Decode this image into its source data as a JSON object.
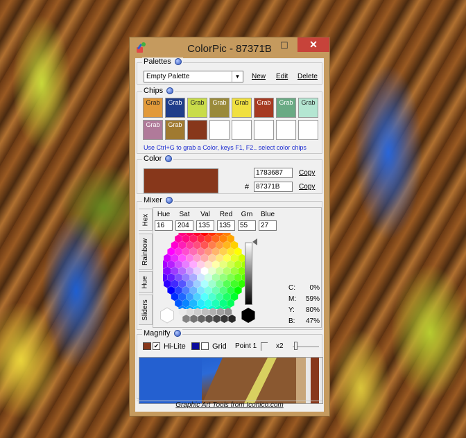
{
  "window": {
    "title": "ColorPic - 87371B",
    "minimize": "–",
    "maximize": "☐",
    "close": "✕"
  },
  "palettes": {
    "label": "Palettes",
    "selected": "Empty Palette",
    "new_label": "New",
    "edit_label": "Edit",
    "delete_label": "Delete"
  },
  "chips": {
    "label": "Chips",
    "items": [
      {
        "label": "Grab",
        "color": "#e29a3a"
      },
      {
        "label": "Grab",
        "color": "#1f3d8a"
      },
      {
        "label": "Grab",
        "color": "#c9dc4a"
      },
      {
        "label": "Grab",
        "color": "#9a8a3a"
      },
      {
        "label": "Grab",
        "color": "#f0e040"
      },
      {
        "label": "Grab",
        "color": "#a63a22"
      },
      {
        "label": "Grab",
        "color": "#6aaa84"
      },
      {
        "label": "Grab",
        "color": "#b4e6d2"
      },
      {
        "label": "Grab",
        "color": "#b07a9a"
      },
      {
        "label": "Grab",
        "color": "#a07a30"
      },
      {
        "label": "",
        "color": "#87371b"
      },
      {
        "label": "",
        "color": "#ffffff"
      },
      {
        "label": "",
        "color": "#ffffff"
      },
      {
        "label": "",
        "color": "#ffffff"
      },
      {
        "label": "",
        "color": "#ffffff"
      },
      {
        "label": "",
        "color": "#ffffff"
      }
    ],
    "hint": "Use Ctrl+G to grab a Color, keys F1, F2.. select color chips"
  },
  "color": {
    "label": "Color",
    "swatch": "#87371b",
    "decimal": "1783687",
    "hash": "#",
    "hex": "87371B",
    "copy1": "Copy",
    "copy2": "Copy"
  },
  "mixer": {
    "label": "Mixer",
    "tabs": [
      "Hex",
      "Rainbow",
      "Hue",
      "Sliders"
    ],
    "headers": [
      "Hue",
      "Sat",
      "Val",
      "Red",
      "Grn",
      "Blue"
    ],
    "values": [
      "16",
      "204",
      "135",
      "135",
      "55",
      "27"
    ],
    "cmyk": [
      {
        "k": "C:",
        "v": "0%"
      },
      {
        "k": "M:",
        "v": "59%"
      },
      {
        "k": "Y:",
        "v": "80%"
      },
      {
        "k": "B:",
        "v": "47%"
      }
    ]
  },
  "magnify": {
    "label": "Magnify",
    "hilite_color": "#87371b",
    "hilite_label": "Hi-Lite",
    "grid_color": "#0a0a9a",
    "grid_label": "Grid",
    "point_label": "Point 1",
    "zoom_label": "x2"
  },
  "footer": {
    "text": "Graphic Art Tools from Iconico.com"
  }
}
